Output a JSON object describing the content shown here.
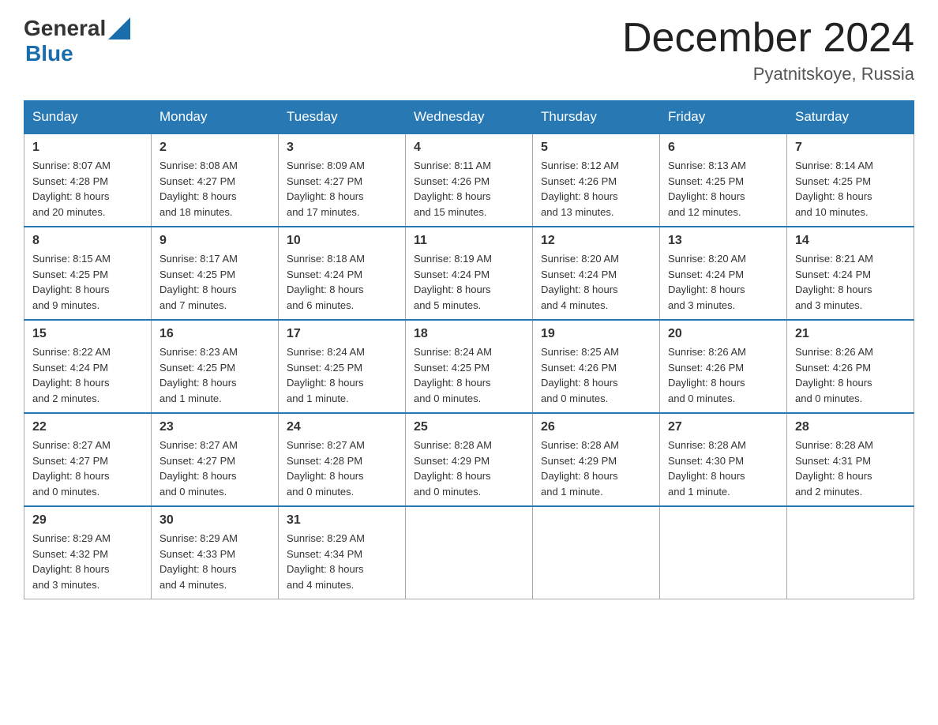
{
  "header": {
    "logo_general": "General",
    "logo_blue": "Blue",
    "month_title": "December 2024",
    "location": "Pyatnitskoye, Russia"
  },
  "days_of_week": [
    "Sunday",
    "Monday",
    "Tuesday",
    "Wednesday",
    "Thursday",
    "Friday",
    "Saturday"
  ],
  "weeks": [
    [
      {
        "num": "1",
        "sunrise": "8:07 AM",
        "sunset": "4:28 PM",
        "daylight": "8 hours and 20 minutes."
      },
      {
        "num": "2",
        "sunrise": "8:08 AM",
        "sunset": "4:27 PM",
        "daylight": "8 hours and 18 minutes."
      },
      {
        "num": "3",
        "sunrise": "8:09 AM",
        "sunset": "4:27 PM",
        "daylight": "8 hours and 17 minutes."
      },
      {
        "num": "4",
        "sunrise": "8:11 AM",
        "sunset": "4:26 PM",
        "daylight": "8 hours and 15 minutes."
      },
      {
        "num": "5",
        "sunrise": "8:12 AM",
        "sunset": "4:26 PM",
        "daylight": "8 hours and 13 minutes."
      },
      {
        "num": "6",
        "sunrise": "8:13 AM",
        "sunset": "4:25 PM",
        "daylight": "8 hours and 12 minutes."
      },
      {
        "num": "7",
        "sunrise": "8:14 AM",
        "sunset": "4:25 PM",
        "daylight": "8 hours and 10 minutes."
      }
    ],
    [
      {
        "num": "8",
        "sunrise": "8:15 AM",
        "sunset": "4:25 PM",
        "daylight": "8 hours and 9 minutes."
      },
      {
        "num": "9",
        "sunrise": "8:17 AM",
        "sunset": "4:25 PM",
        "daylight": "8 hours and 7 minutes."
      },
      {
        "num": "10",
        "sunrise": "8:18 AM",
        "sunset": "4:24 PM",
        "daylight": "8 hours and 6 minutes."
      },
      {
        "num": "11",
        "sunrise": "8:19 AM",
        "sunset": "4:24 PM",
        "daylight": "8 hours and 5 minutes."
      },
      {
        "num": "12",
        "sunrise": "8:20 AM",
        "sunset": "4:24 PM",
        "daylight": "8 hours and 4 minutes."
      },
      {
        "num": "13",
        "sunrise": "8:20 AM",
        "sunset": "4:24 PM",
        "daylight": "8 hours and 3 minutes."
      },
      {
        "num": "14",
        "sunrise": "8:21 AM",
        "sunset": "4:24 PM",
        "daylight": "8 hours and 3 minutes."
      }
    ],
    [
      {
        "num": "15",
        "sunrise": "8:22 AM",
        "sunset": "4:24 PM",
        "daylight": "8 hours and 2 minutes."
      },
      {
        "num": "16",
        "sunrise": "8:23 AM",
        "sunset": "4:25 PM",
        "daylight": "8 hours and 1 minute."
      },
      {
        "num": "17",
        "sunrise": "8:24 AM",
        "sunset": "4:25 PM",
        "daylight": "8 hours and 1 minute."
      },
      {
        "num": "18",
        "sunrise": "8:24 AM",
        "sunset": "4:25 PM",
        "daylight": "8 hours and 0 minutes."
      },
      {
        "num": "19",
        "sunrise": "8:25 AM",
        "sunset": "4:26 PM",
        "daylight": "8 hours and 0 minutes."
      },
      {
        "num": "20",
        "sunrise": "8:26 AM",
        "sunset": "4:26 PM",
        "daylight": "8 hours and 0 minutes."
      },
      {
        "num": "21",
        "sunrise": "8:26 AM",
        "sunset": "4:26 PM",
        "daylight": "8 hours and 0 minutes."
      }
    ],
    [
      {
        "num": "22",
        "sunrise": "8:27 AM",
        "sunset": "4:27 PM",
        "daylight": "8 hours and 0 minutes."
      },
      {
        "num": "23",
        "sunrise": "8:27 AM",
        "sunset": "4:27 PM",
        "daylight": "8 hours and 0 minutes."
      },
      {
        "num": "24",
        "sunrise": "8:27 AM",
        "sunset": "4:28 PM",
        "daylight": "8 hours and 0 minutes."
      },
      {
        "num": "25",
        "sunrise": "8:28 AM",
        "sunset": "4:29 PM",
        "daylight": "8 hours and 0 minutes."
      },
      {
        "num": "26",
        "sunrise": "8:28 AM",
        "sunset": "4:29 PM",
        "daylight": "8 hours and 1 minute."
      },
      {
        "num": "27",
        "sunrise": "8:28 AM",
        "sunset": "4:30 PM",
        "daylight": "8 hours and 1 minute."
      },
      {
        "num": "28",
        "sunrise": "8:28 AM",
        "sunset": "4:31 PM",
        "daylight": "8 hours and 2 minutes."
      }
    ],
    [
      {
        "num": "29",
        "sunrise": "8:29 AM",
        "sunset": "4:32 PM",
        "daylight": "8 hours and 3 minutes."
      },
      {
        "num": "30",
        "sunrise": "8:29 AM",
        "sunset": "4:33 PM",
        "daylight": "8 hours and 4 minutes."
      },
      {
        "num": "31",
        "sunrise": "8:29 AM",
        "sunset": "4:34 PM",
        "daylight": "8 hours and 4 minutes."
      },
      null,
      null,
      null,
      null
    ]
  ],
  "labels": {
    "sunrise": "Sunrise:",
    "sunset": "Sunset:",
    "daylight": "Daylight:"
  }
}
